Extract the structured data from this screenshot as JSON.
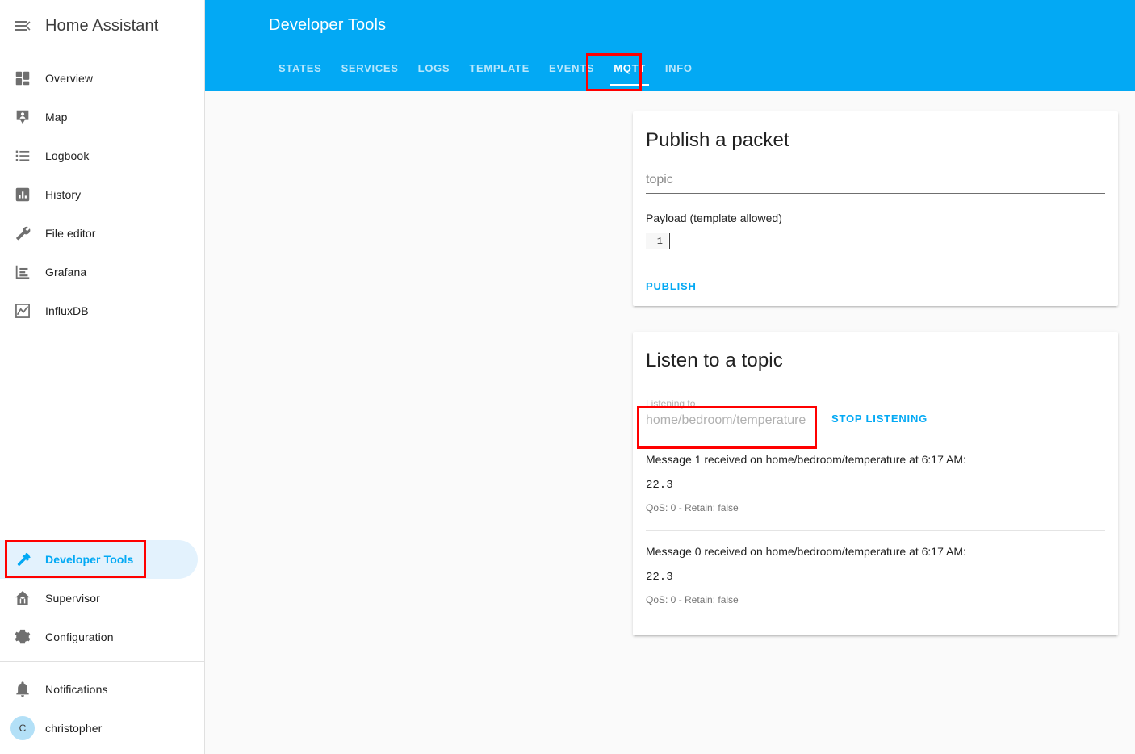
{
  "sidebar": {
    "title": "Home Assistant",
    "menu_icon": "menu-open-icon",
    "items": [
      {
        "label": "Overview",
        "icon": "view-dashboard-icon"
      },
      {
        "label": "Map",
        "icon": "map-marker-account-icon"
      },
      {
        "label": "Logbook",
        "icon": "format-list-bulleted-icon"
      },
      {
        "label": "History",
        "icon": "chart-box-icon"
      },
      {
        "label": "File editor",
        "icon": "wrench-icon"
      },
      {
        "label": "Grafana",
        "icon": "chart-bar-outline-icon"
      },
      {
        "label": "InfluxDB",
        "icon": "chart-line-icon"
      },
      {
        "label": "Developer Tools",
        "icon": "hammer-icon"
      },
      {
        "label": "Supervisor",
        "icon": "home-assistant-house-icon"
      },
      {
        "label": "Configuration",
        "icon": "cog-icon"
      }
    ],
    "active_item": "Developer Tools",
    "bottom": {
      "notifications_label": "Notifications",
      "notifications_icon": "bell-icon",
      "user_name": "christopher",
      "user_initial": "C"
    }
  },
  "header": {
    "title": "Developer Tools",
    "accent_color": "#03a9f4",
    "tabs": [
      {
        "label": "STATES"
      },
      {
        "label": "SERVICES"
      },
      {
        "label": "LOGS"
      },
      {
        "label": "TEMPLATE"
      },
      {
        "label": "EVENTS"
      },
      {
        "label": "MQTT"
      },
      {
        "label": "INFO"
      }
    ],
    "active_tab": "MQTT"
  },
  "publish_card": {
    "title": "Publish a packet",
    "topic_value": "",
    "topic_placeholder": "topic",
    "payload_label": "Payload (template allowed)",
    "payload_line_number": "1",
    "payload_value": "",
    "publish_label": "PUBLISH"
  },
  "listen_card": {
    "title": "Listen to a topic",
    "listening_label": "Listening to",
    "listening_value": "home/bedroom/temperature",
    "stop_label": "STOP LISTENING",
    "messages": [
      {
        "head": "Message 1 received on home/bedroom/temperature at 6:17 AM:",
        "payload": "22.3",
        "meta": "QoS: 0 - Retain: false"
      },
      {
        "head": "Message 0 received on home/bedroom/temperature at 6:17 AM:",
        "payload": "22.3",
        "meta": "QoS: 0 - Retain: false"
      }
    ]
  },
  "annotations": {
    "color": "#ff0000",
    "boxes": [
      {
        "target": "tab-mqtt"
      },
      {
        "target": "sidebar-item-developer-tools"
      },
      {
        "target": "listening-to-field"
      }
    ]
  }
}
